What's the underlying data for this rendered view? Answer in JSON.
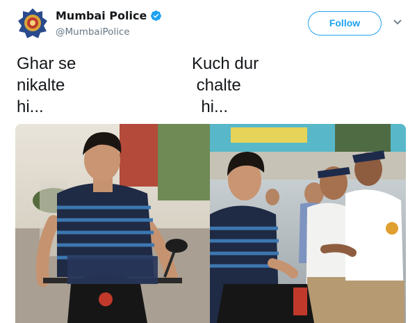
{
  "tweet": {
    "display_name": "Mumbai Police",
    "handle": "@MumbaiPolice",
    "follow_label": "Follow",
    "caption_left": [
      "Ghar se",
      "nikalte",
      "hi..."
    ],
    "caption_right": [
      "Kuch dur",
      " chalte",
      "  hi..."
    ]
  },
  "icons": {
    "avatar": "mumbai-police-emblem",
    "verified": "verified-badge-icon",
    "menu": "chevron-down-icon"
  },
  "colors": {
    "accent": "#1da1f2",
    "secondary_text": "#657786",
    "primary_text": "#14171a"
  }
}
